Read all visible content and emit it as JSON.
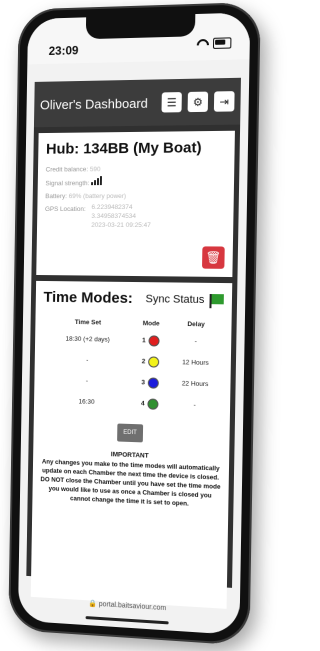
{
  "status": {
    "time": "23:09",
    "battery": ""
  },
  "header": {
    "title": "Oliver's Dashboard"
  },
  "hub": {
    "title": "Hub: 134BB (My Boat)",
    "credit_label": "Credit balance:",
    "credit_value": "590",
    "signal_label": "Signal strength:",
    "battery_label": "Battery:",
    "battery_value": "69% (battery power)",
    "gps_label": "GPS Location:",
    "gps_line1": "6.2239482374",
    "gps_line2": "3.34958374534",
    "gps_line3": "2023-03-21 09:25:47"
  },
  "time_modes": {
    "title": "Time Modes:",
    "sync_label": "Sync Status",
    "col_time": "Time Set",
    "col_mode": "Mode",
    "col_delay": "Delay",
    "rows": [
      {
        "time": "18:30 (+2 days)",
        "mode": "1",
        "color": "#e01f1f",
        "delay": "-"
      },
      {
        "time": "-",
        "mode": "2",
        "color": "#f3f31a",
        "delay": "12 Hours"
      },
      {
        "time": "-",
        "mode": "3",
        "color": "#1b1bdc",
        "delay": "22 Hours"
      },
      {
        "time": "16:30",
        "mode": "4",
        "color": "#2f8f2f",
        "delay": "-"
      }
    ],
    "edit_label": "EDIT",
    "important_title": "IMPORTANT",
    "important_text": "Any changes you make to the time modes will automatically update on each Chamber the next time the device is closed. DO NOT close the Chamber until you have set the time mode you would like to use as once a Chamber is closed you cannot change the time it is set to open."
  },
  "browser": {
    "url": "portal.baitsaviour.com"
  }
}
